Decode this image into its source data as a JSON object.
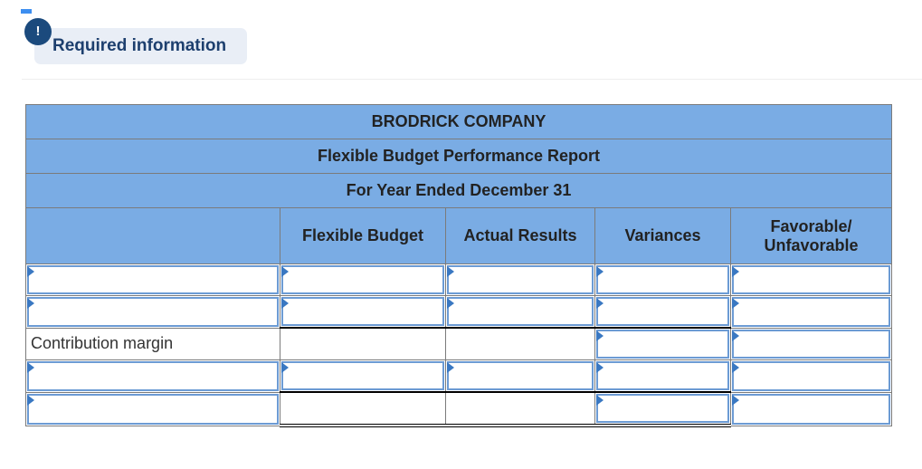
{
  "required_info": {
    "icon": "exclamation-icon",
    "icon_glyph": "!",
    "label": "Required information"
  },
  "report": {
    "company": "BRODRICK COMPANY",
    "title": "Flexible Budget Performance Report",
    "period": "For Year Ended December 31",
    "columns": [
      "",
      "Flexible Budget",
      "Actual Results",
      "Variances",
      "Favorable/\nUnfavorable"
    ],
    "column_labels": {
      "flexible_budget": "Flexible Budget",
      "actual_results": "Actual Results",
      "variances": "Variances",
      "fav_line1": "Favorable/",
      "fav_line2": "Unfavorable"
    },
    "rows": [
      {
        "label": "",
        "flexible_budget": "",
        "actual_results": "",
        "variances": "",
        "favorable_unfavorable": ""
      },
      {
        "label": "",
        "flexible_budget": "",
        "actual_results": "",
        "variances": "",
        "favorable_unfavorable": ""
      },
      {
        "label": "Contribution margin",
        "flexible_budget": "",
        "actual_results": "",
        "variances": "",
        "favorable_unfavorable": ""
      },
      {
        "label": "",
        "flexible_budget": "",
        "actual_results": "",
        "variances": "",
        "favorable_unfavorable": ""
      },
      {
        "label": "",
        "flexible_budget": "",
        "actual_results": "",
        "variances": "",
        "favorable_unfavorable": ""
      }
    ]
  }
}
